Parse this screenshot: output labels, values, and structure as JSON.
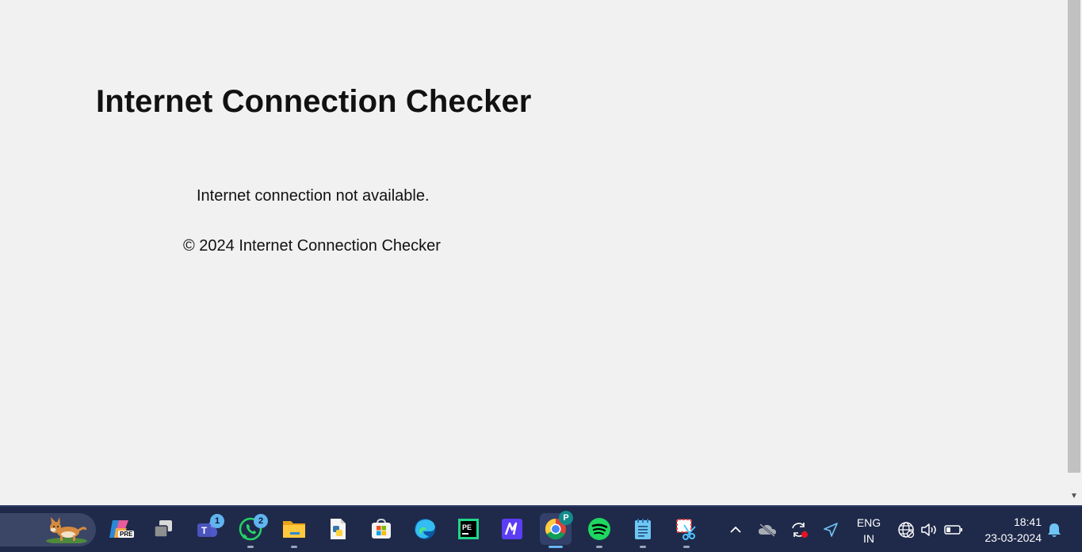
{
  "page": {
    "title": "Internet Connection Checker",
    "status_text": "Internet connection not available.",
    "footer": "© 2024 Internet Connection Checker"
  },
  "taskbar": {
    "apps": [
      {
        "name": "copilot-pre",
        "badge": "PRE"
      },
      {
        "name": "task-view"
      },
      {
        "name": "microsoft-teams",
        "badge": "1"
      },
      {
        "name": "whatsapp",
        "badge": "2"
      },
      {
        "name": "file-explorer"
      },
      {
        "name": "python-idle"
      },
      {
        "name": "microsoft-store"
      },
      {
        "name": "microsoft-edge"
      },
      {
        "name": "pycharm",
        "label": "PE"
      },
      {
        "name": "app-m"
      },
      {
        "name": "google-chrome",
        "badge": "P"
      },
      {
        "name": "spotify"
      },
      {
        "name": "notepad"
      },
      {
        "name": "snipping-tool"
      }
    ],
    "tray": {
      "language_line1": "ENG",
      "language_line2": "IN",
      "time": "18:41",
      "date": "23-03-2024"
    }
  },
  "colors": {
    "page_background": "#f1f1f1",
    "taskbar_background": "#1f2a4a",
    "text": "#111111",
    "accent": "#66b6f2"
  }
}
